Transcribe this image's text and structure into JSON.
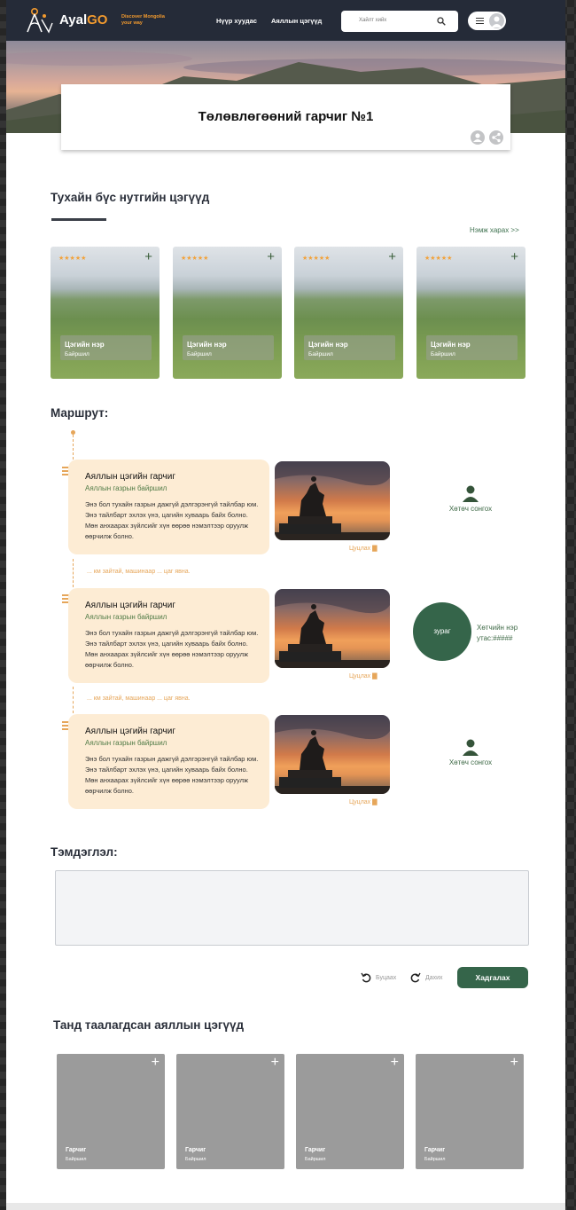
{
  "header": {
    "brand_main": "Ayal",
    "brand_accent": "GO",
    "tagline": "Discover Mongolia your way",
    "nav": [
      "Нүүр хуудас",
      "Аяллын цэгүүд"
    ],
    "search_placeholder": "Хайлт хийх"
  },
  "plan": {
    "title": "Төлөвлөгөөний гарчиг №1"
  },
  "places": {
    "heading": "Тухайн бүс нутгийн цэгүүд",
    "more_link": "Нэмж харах >>",
    "stars": "★★★★★",
    "items": [
      {
        "name": "Цэгийн нэр",
        "location": "Байршил"
      },
      {
        "name": "Цэгийн нэр",
        "location": "Байршил"
      },
      {
        "name": "Цэгийн нэр",
        "location": "Байршил"
      },
      {
        "name": "Цэгийн нэр",
        "location": "Байршил"
      }
    ]
  },
  "route": {
    "heading": "Маршрут:",
    "stops": [
      {
        "title": "Аяллын цэгийн гарчиг",
        "subtitle": "Аяллын газрын байршил",
        "desc": "Энэ бол тухайн газрын дажгүй дэлгэрэнгүй тайлбар юм. Энэ тайлбарт эхлэх үнэ, цагийн хуваарь байх болно. Мөн анхаарах зүйлсийг хүн өөрөө нэмэлтээр оруулж өөрчилж болно.",
        "delete": "Цуцлах"
      },
      {
        "title": "Аяллын цэгийн гарчиг",
        "subtitle": "Аяллын газрын байршил",
        "desc": "Энэ бол тухайн газрын дажгүй дэлгэрэнгүй тайлбар юм. Энэ тайлбарт эхлэх үнэ, цагийн хуваарь байх болно. Мөн анхаарах зүйлсийг хүн өөрөө нэмэлтээр оруулж өөрчилж болно.",
        "delete": "Цуцлах"
      },
      {
        "title": "Аяллын цэгийн гарчиг",
        "subtitle": "Аяллын газрын байршил",
        "desc": "Энэ бол тухайн газрын дажгүй дэлгэрэнгүй тайлбар юм. Энэ тайлбарт эхлэх үнэ, цагийн хуваарь байх болно. Мөн анхаарах зүйлсийг хүн өөрөө нэмэлтээр оруулж өөрчилж болно.",
        "delete": "Цуцлах"
      }
    ],
    "travel_notes": [
      "... км зайтай, машинаар ... цаг явна.",
      "... км зайтай, машинаар ... цаг явна."
    ],
    "guide_select": "Хөтөч сонгох",
    "guide_photo": "зураг",
    "guide_name": "Хөтчийн нэр",
    "guide_phone": "утас:#####"
  },
  "notes": {
    "heading": "Тэмдэглэл:",
    "value": ""
  },
  "actions": {
    "undo": "Буцаах",
    "redo": "Дахих",
    "save": "Хадгалах"
  },
  "liked": {
    "heading": "Танд таалагдсан аяллын цэгүүд",
    "items": [
      {
        "name": "Гарчиг",
        "location": "Байршил"
      },
      {
        "name": "Гарчиг",
        "location": "Байршил"
      },
      {
        "name": "Гарчиг",
        "location": "Байршил"
      },
      {
        "name": "Гарчиг",
        "location": "Байршил"
      }
    ]
  }
}
